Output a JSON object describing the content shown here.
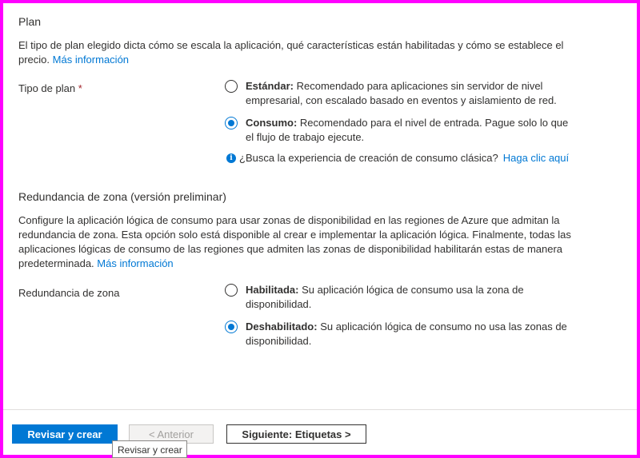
{
  "plan": {
    "heading": "Plan",
    "description": "El tipo de plan elegido dicta cómo se escala la aplicación, qué características están habilitadas y cómo se establece el precio.",
    "more_info": "Más información",
    "field_label": "Tipo de plan",
    "required_mark": "*",
    "options": [
      {
        "title": "Estándar:",
        "text": "Recomendado para aplicaciones sin servidor de nivel empresarial, con escalado basado en eventos y aislamiento de red.",
        "checked": false
      },
      {
        "title": "Consumo:",
        "text": "Recomendado para el nivel de entrada. Pague solo lo que el flujo de trabajo ejecute.",
        "checked": true
      }
    ],
    "info_text": "¿Busca la experiencia de creación de consumo clásica?",
    "info_link": "Haga clic aquí"
  },
  "zone": {
    "heading": "Redundancia de zona (versión preliminar)",
    "description": "Configure la aplicación lógica de consumo para usar zonas de disponibilidad en las regiones de Azure que admitan la redundancia de zona. Esta opción solo está disponible al crear e implementar la aplicación lógica. Finalmente, todas las aplicaciones lógicas de consumo de las regiones que admiten las zonas de disponibilidad habilitarán estas de manera predeterminada.",
    "more_info": "Más información",
    "field_label": "Redundancia de zona",
    "options": [
      {
        "title": "Habilitada:",
        "text": "Su aplicación lógica de consumo usa la zona de disponibilidad.",
        "checked": false
      },
      {
        "title": "Deshabilitado:",
        "text": "Su aplicación lógica de consumo no usa las zonas de disponibilidad.",
        "checked": true
      }
    ]
  },
  "footer": {
    "review_create": "Revisar y crear",
    "previous": "< Anterior",
    "next": "Siguiente: Etiquetas >",
    "tooltip": "Revisar y crear"
  },
  "colors": {
    "accent": "#0078d4",
    "frame": "#ff00ff"
  }
}
